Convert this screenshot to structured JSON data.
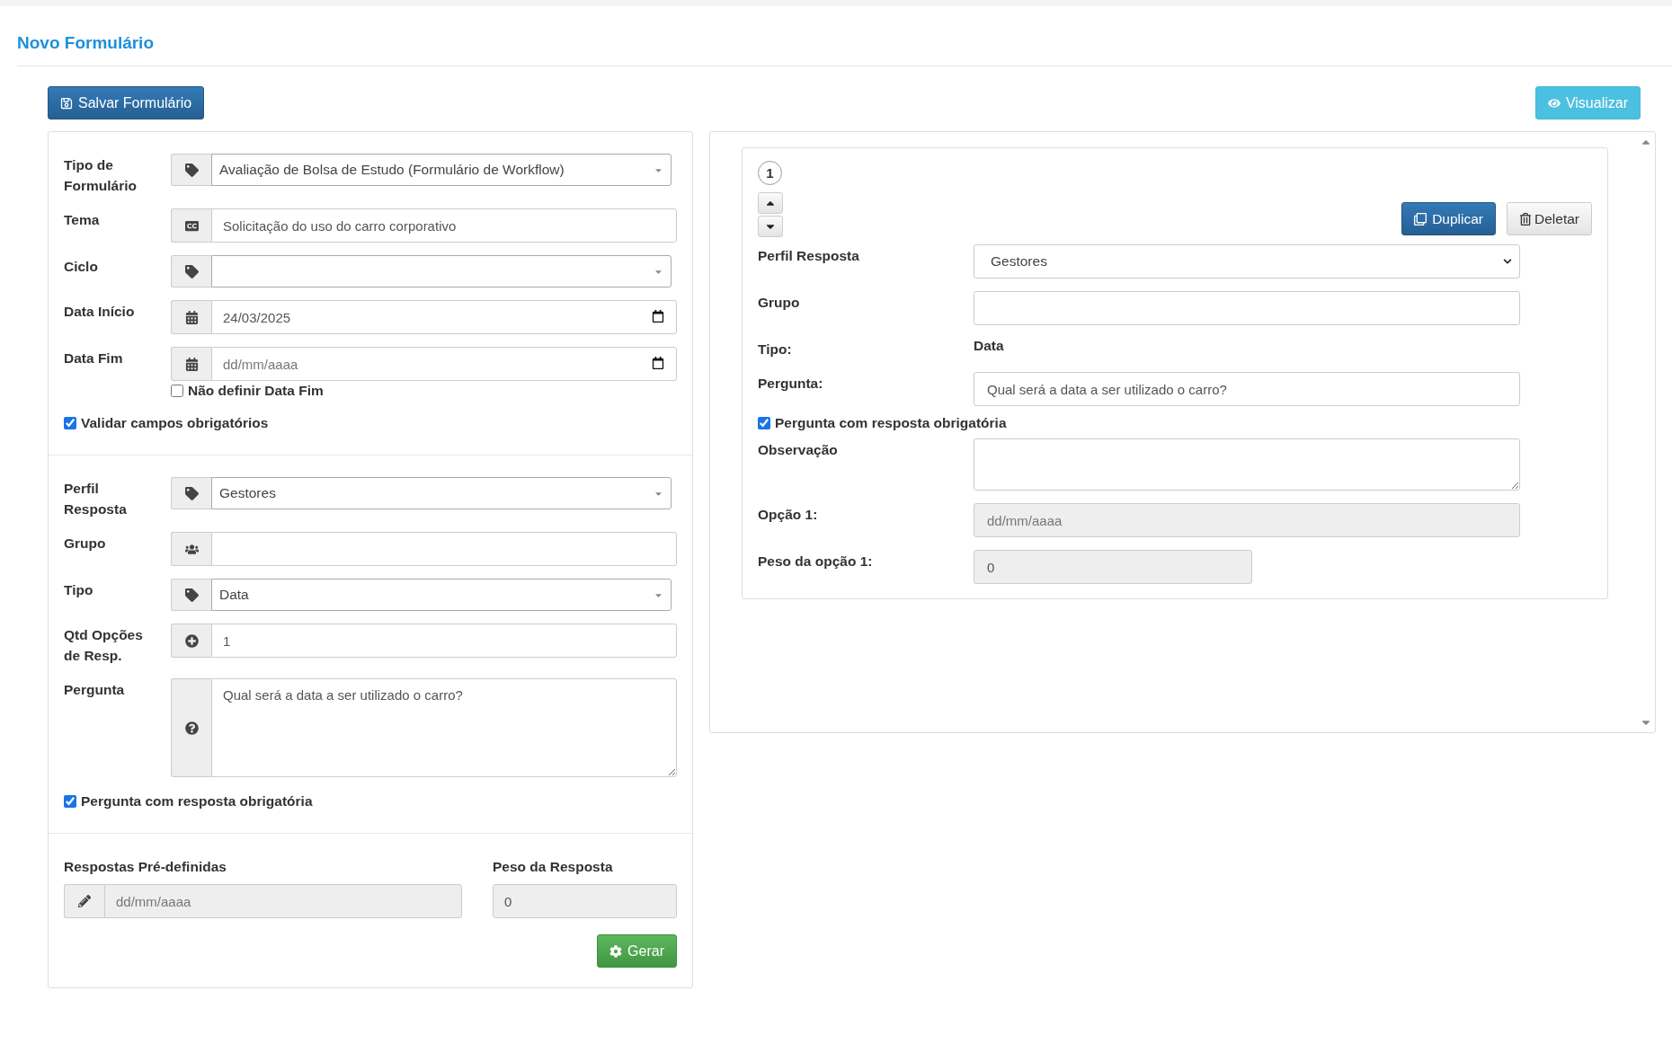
{
  "page": {
    "title": "Novo Formulário"
  },
  "toolbar": {
    "save_label": "Salvar Formulário",
    "preview_label": "Visualizar"
  },
  "form": {
    "sections": [
      {
        "rows": [
          {
            "label": "Tipo de Formulário",
            "kind": "select",
            "value": "Avaliação de Bolsa de Estudo (Formulário de Workflow)"
          },
          {
            "label": "Tema",
            "kind": "text",
            "value": "Solicitação do uso do carro corporativo"
          },
          {
            "label": "Ciclo",
            "kind": "select"
          },
          {
            "label": "Data Início",
            "kind": "date",
            "value": "24/03/2025"
          },
          {
            "label": "Data Fim",
            "kind": "date",
            "placeholder": "dd/mm/aaaa"
          },
          {
            "label": "Não definir Data Fim",
            "kind": "option",
            "checked": false
          },
          {
            "label": "Validar campos obrigatórios",
            "kind": "checkbox",
            "checked": true
          }
        ]
      },
      {
        "rows": [
          {
            "label": "Perfil Resposta",
            "kind": "select",
            "value": "Gestores"
          },
          {
            "label": "Grupo",
            "kind": "text"
          },
          {
            "label": "Tipo",
            "kind": "select",
            "value": "Data"
          },
          {
            "label": "Qtd Opções de Resp.",
            "kind": "text",
            "value": "1"
          },
          {
            "label": "Pergunta",
            "kind": "textarea",
            "value": "Qual será a data a ser utilizado o carro?"
          },
          {
            "label": "Pergunta com resposta obrigatória",
            "kind": "checkbox",
            "checked": true
          }
        ]
      }
    ],
    "predefined": {
      "answers_label": "Respostas Pré-definidas",
      "answers_placeholder": "dd/mm/aaaa",
      "disabled": true,
      "weight_label": "Peso da Resposta",
      "weight_value": "0",
      "generate_label": "Gerar"
    }
  },
  "questions": [
    {
      "number": "1",
      "duplicate_label": "Duplicar",
      "delete_label": "Deletar",
      "rows": [
        {
          "label": "Perfil Resposta",
          "kind": "select",
          "value": "Gestores"
        },
        {
          "label": "Grupo",
          "kind": "text"
        },
        {
          "label": "Tipo:",
          "kind": "static",
          "value": "Data"
        },
        {
          "label": "Pergunta:",
          "kind": "text",
          "value": "Qual será a data a ser utilizado o carro?"
        },
        {
          "label": "Pergunta com resposta obrigatória",
          "kind": "checkbox",
          "checked": true
        },
        {
          "label": "Observação",
          "kind": "textarea"
        },
        {
          "label": "Opção 1:",
          "kind": "text",
          "placeholder": "dd/mm/aaaa",
          "disabled": true
        },
        {
          "label": "Peso da opção 1:",
          "kind": "short",
          "value": "0",
          "disabled": true
        }
      ]
    }
  ]
}
